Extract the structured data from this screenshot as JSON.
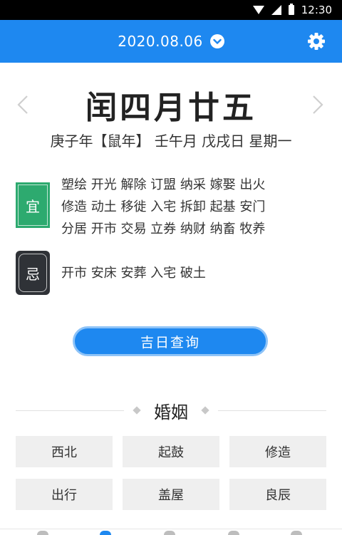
{
  "status_bar": {
    "time": "12:30"
  },
  "header": {
    "date": "2020.08.06"
  },
  "lunar": {
    "title": "闰四月廿五",
    "ganzhi": "庚子年【鼠年】 壬午月 戊戌日 星期一"
  },
  "yi": {
    "label": "宜",
    "lines": [
      "塑绘 开光 解除 订盟 纳采 嫁娶 出火",
      "修造 动土 移徙 入宅 拆卸 起基 安门",
      "分居 开市 交易 立券 纳财 纳畜 牧养"
    ]
  },
  "ji": {
    "label": "忌",
    "lines": [
      "开市 安床 安葬 入宅 破土"
    ]
  },
  "query_button": "吉日查询",
  "section": {
    "title": "婚姻",
    "cells": [
      "西北",
      "起鼓",
      "修造",
      "出行",
      "盖屋",
      "良辰"
    ]
  },
  "colors": {
    "primary": "#1e88f0",
    "yi_badge": "#2daa6f",
    "ji_badge": "#2f3237"
  },
  "icons": [
    "wifi-icon",
    "signal-icon",
    "battery-icon",
    "chevron-down-icon",
    "gear-icon",
    "arrow-left-icon",
    "arrow-right-icon",
    "diamond-icon"
  ]
}
